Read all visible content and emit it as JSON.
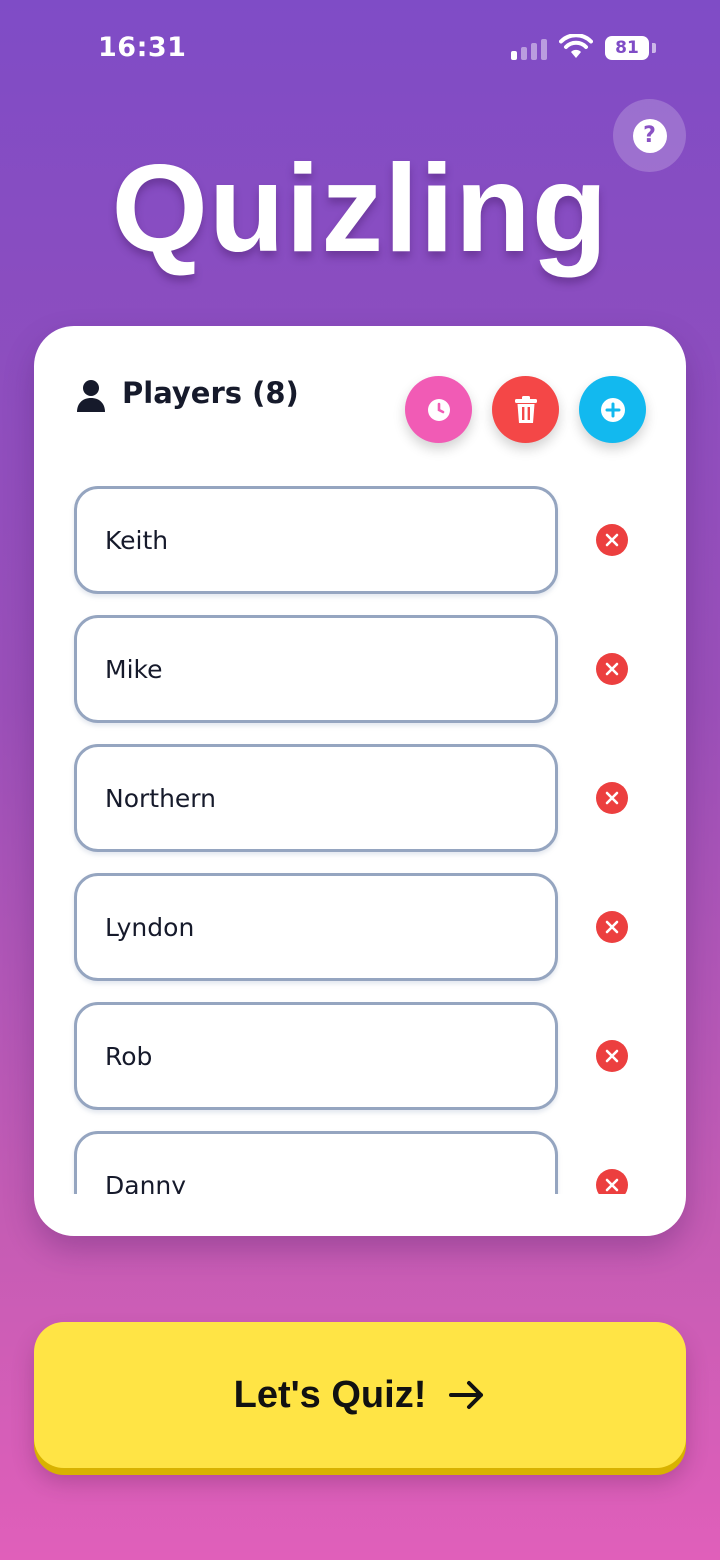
{
  "status_bar": {
    "time": "16:31",
    "battery": "81"
  },
  "header": {
    "title": "Quizling"
  },
  "players": {
    "title": "Players (8)",
    "list": [
      {
        "name": "Keith"
      },
      {
        "name": "Mike"
      },
      {
        "name": "Northern"
      },
      {
        "name": "Lyndon"
      },
      {
        "name": "Rob"
      },
      {
        "name": "Danny"
      }
    ]
  },
  "actions": {
    "history_icon": "clock-icon",
    "clear_icon": "trash-icon",
    "add_icon": "plus-icon",
    "remove_icon": "close-icon",
    "help_label": "?"
  },
  "cta": {
    "label": "Let's Quiz!"
  },
  "colors": {
    "gradient_top": "#7f4cc6",
    "gradient_bottom": "#e05fba",
    "history_pink": "#f15bb5",
    "clear_red": "#f44747",
    "add_blue": "#12b9ef",
    "remove_red": "#ec3f3f",
    "cta_yellow": "#ffe445"
  }
}
